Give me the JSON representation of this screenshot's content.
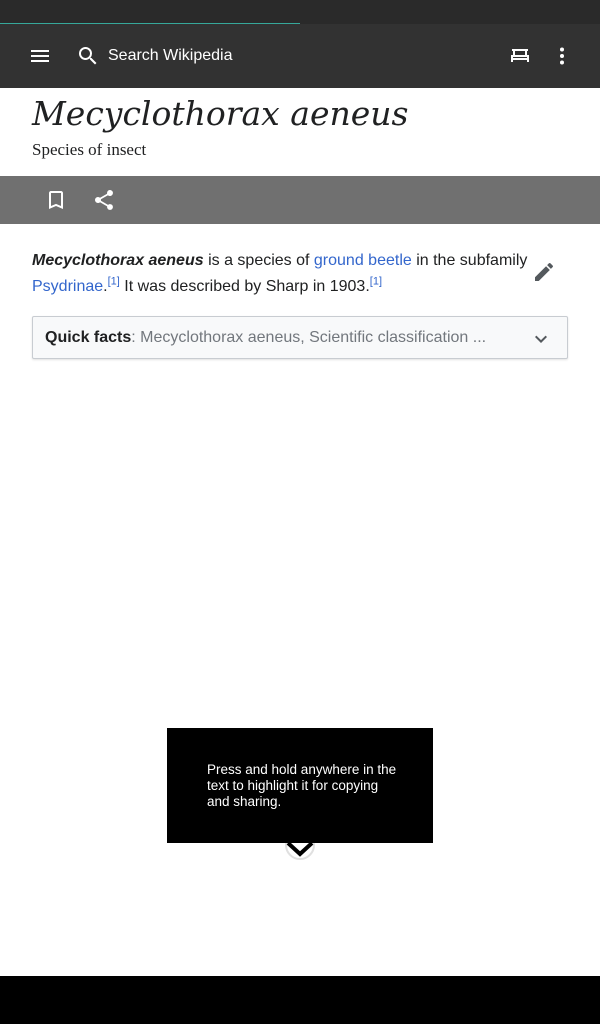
{
  "status_bar": {},
  "page_load": {
    "progress_percent": 50
  },
  "toolbar": {
    "search_placeholder": "Search Wikipedia",
    "icons": [
      "menu-icon",
      "search-icon",
      "reading-lists-icon",
      "more-vert-icon"
    ]
  },
  "article": {
    "title": "Mecyclothorax aeneus",
    "description": "Species of insect",
    "lead": {
      "subject": "Mecyclothorax aeneus",
      "text_1": " is a species of ",
      "link_1": "ground beetle",
      "text_2": " in the subfamily ",
      "link_2": "Psydrinae",
      "text_3": ".",
      "ref_1": "[1]",
      "text_4": " It was described by Sharp in 1903.",
      "ref_2": "[1]"
    },
    "quick_facts": {
      "label": "Quick facts",
      "summary": ": Mecyclothorax aeneus, Scientific classification ..."
    }
  },
  "action_bar": {
    "icons": [
      "bookmark-icon",
      "share-icon"
    ]
  },
  "tooltip": {
    "text": "Press and hold anywhere in the text to highlight it for copying and sharing."
  },
  "colors": {
    "toolbar_bg": "#323232",
    "action_bar_bg": "#707070",
    "link": "#3366cc",
    "progress_accent": "#36a89a"
  }
}
